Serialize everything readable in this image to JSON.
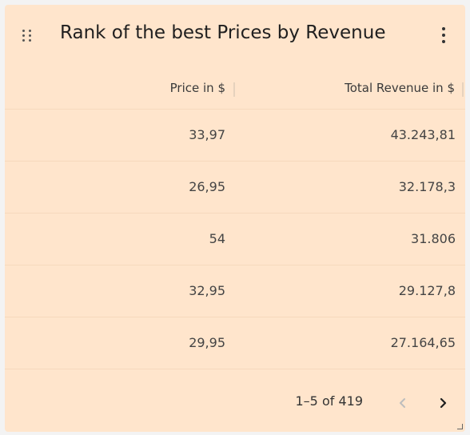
{
  "widget": {
    "title": "Rank of the best Prices by Revenue",
    "drag_icon": "drag-handle-icon",
    "menu_icon": "more-vert-icon",
    "background": "#ffe5cc"
  },
  "table": {
    "columns": [
      "Price in $",
      "Total Revenue in $"
    ],
    "rows": [
      {
        "price": "33,97",
        "revenue": "43.243,81"
      },
      {
        "price": "26,95",
        "revenue": "32.178,3"
      },
      {
        "price": "54",
        "revenue": "31.806"
      },
      {
        "price": "32,95",
        "revenue": "29.127,8"
      },
      {
        "price": "29,95",
        "revenue": "27.164,65"
      }
    ]
  },
  "pagination": {
    "range_label": "1–5 of 419",
    "prev_icon": "chevron-left-icon",
    "next_icon": "chevron-right-icon"
  }
}
